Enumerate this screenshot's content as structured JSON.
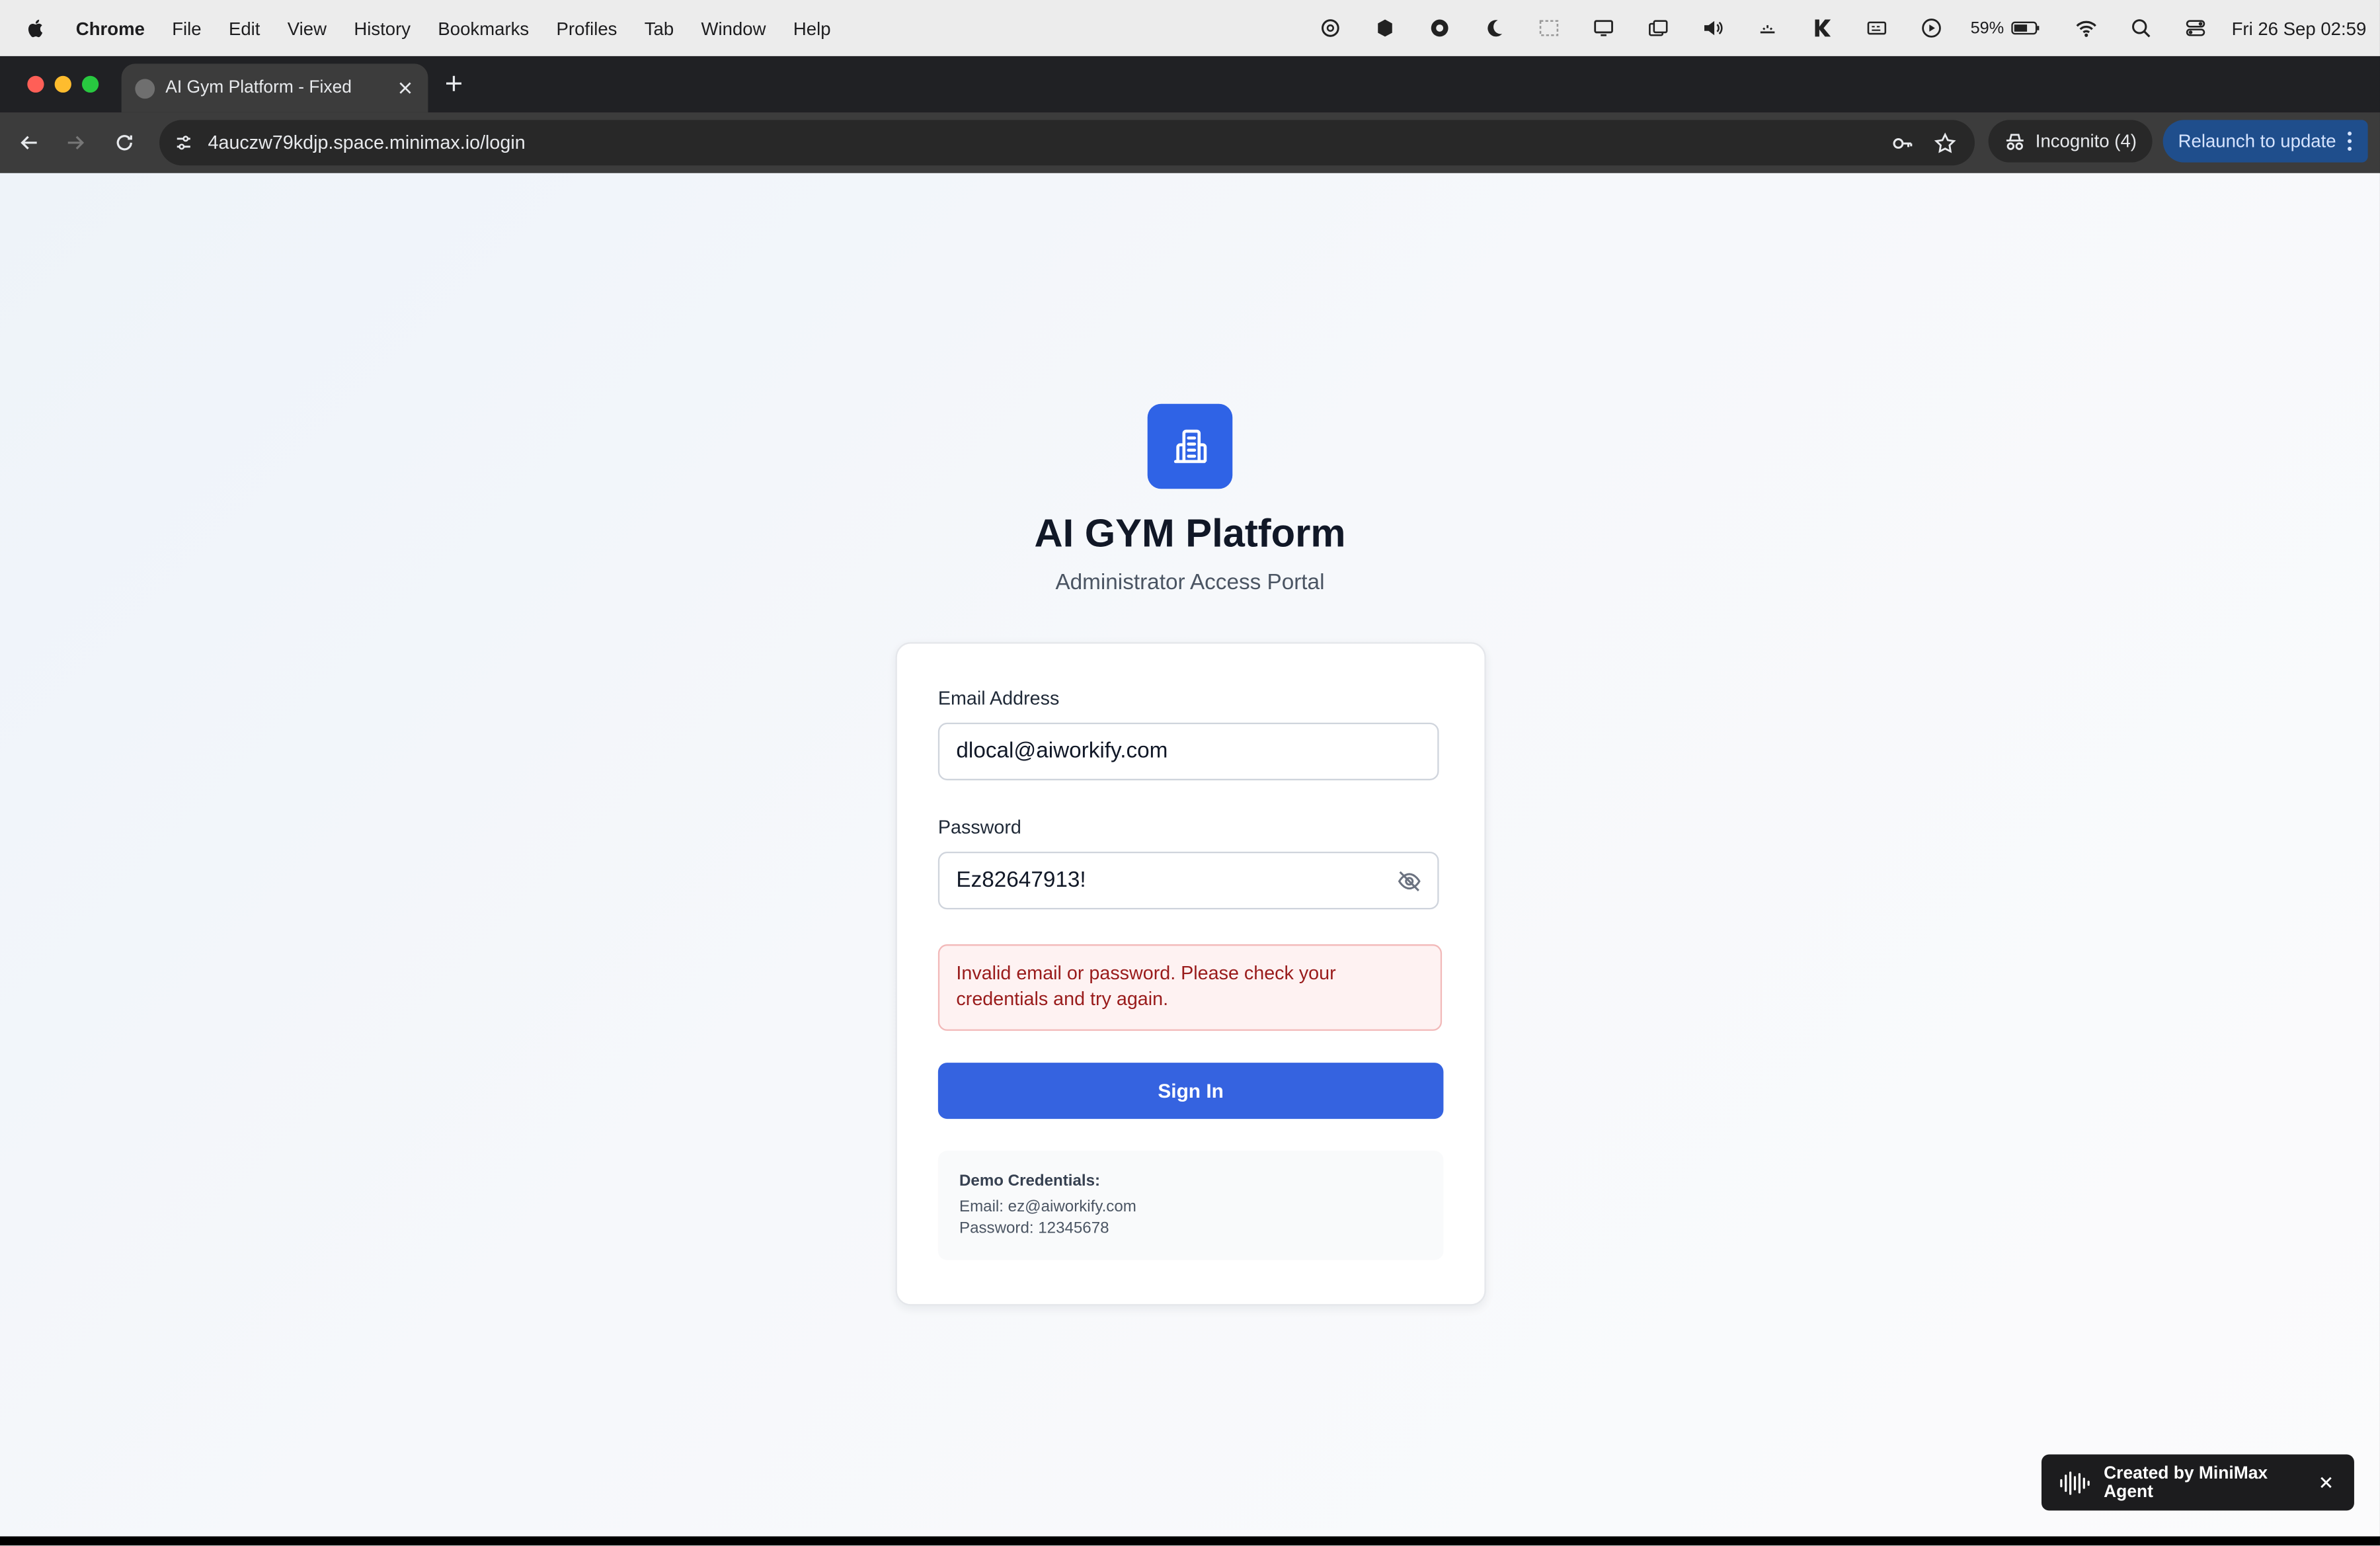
{
  "menubar": {
    "app_name": "Chrome",
    "items": [
      "File",
      "Edit",
      "View",
      "History",
      "Bookmarks",
      "Profiles",
      "Tab",
      "Window",
      "Help"
    ],
    "battery_percent": "59%",
    "datetime": "Fri 26 Sep  02:59"
  },
  "browser": {
    "tab_title": "AI Gym Platform - Fixed",
    "url": "4auczw79kdjp.space.minimax.io/login",
    "incognito_label": "Incognito (4)",
    "relaunch_label": "Relaunch to update"
  },
  "login": {
    "title": "AI GYM Platform",
    "subtitle": "Administrator Access Portal",
    "email_label": "Email Address",
    "email_value": "dlocal@aiworkify.com",
    "password_label": "Password",
    "password_value": "Ez82647913!",
    "error_line1": "Invalid email or password. Please check your",
    "error_line2": "credentials and try again.",
    "signin_label": "Sign In",
    "demo_title": "Demo Credentials:",
    "demo_email": "Email: ez@aiworkify.com",
    "demo_password": "Password: 12345678"
  },
  "badge": {
    "label": "Created by MiniMax Agent"
  },
  "colors": {
    "primary": "#3563e0",
    "logo": "#2f63e6",
    "error_bg": "#fef2f2",
    "error_text": "#991b1b",
    "relaunch_bg": "#1f4e8c"
  },
  "icons": {
    "logo": "building-icon",
    "password_toggle": "eye-off-icon",
    "badge": "sound-wave-icon"
  }
}
